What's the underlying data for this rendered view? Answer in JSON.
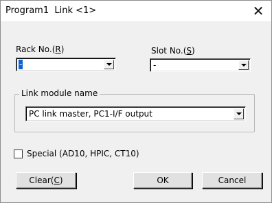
{
  "window": {
    "title": "Program1",
    "subtitle": "Link <1>",
    "close_glyph": "✕"
  },
  "rack": {
    "label_prefix": "Rack No.(",
    "label_key": "R",
    "label_suffix": ")",
    "value": "-"
  },
  "slot": {
    "label_prefix": "Slot No.(",
    "label_key": "S",
    "label_suffix": ")",
    "value": "-"
  },
  "link_module": {
    "group_label": "Link module name",
    "value": "PC link master, PC1-I/F output"
  },
  "special": {
    "label": "Special (AD10, HPIC, CT10)",
    "checked": false
  },
  "buttons": {
    "clear_prefix": "Clear(",
    "clear_key": "C",
    "clear_suffix": ")",
    "ok": "OK",
    "cancel": "Cancel"
  },
  "colors": {
    "selection": "#0a64d8",
    "dialog_bg": "#f0f0f0",
    "title_bg": "#ffffff"
  }
}
